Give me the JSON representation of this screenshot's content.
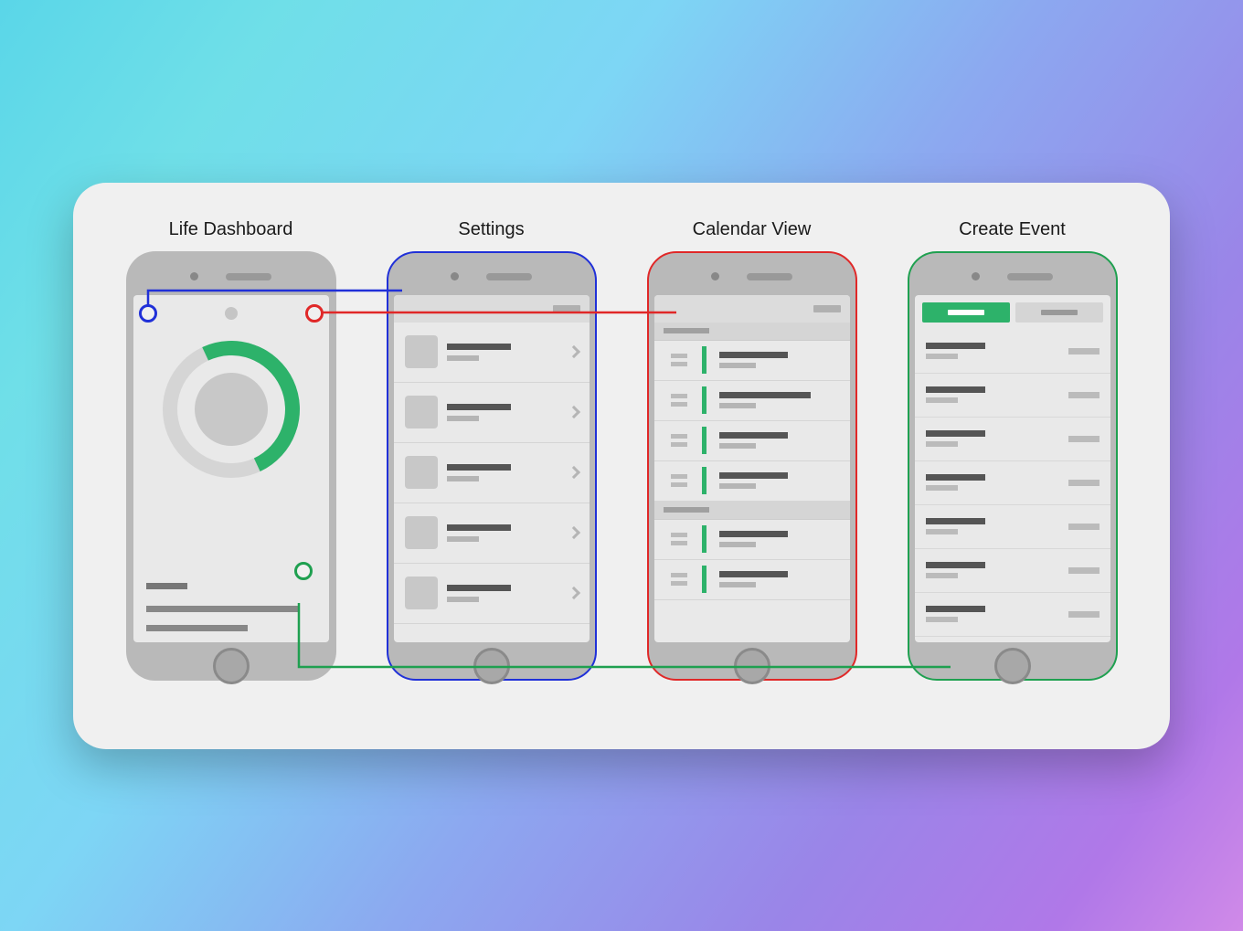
{
  "screens": [
    {
      "title": "Life Dashboard",
      "border": "none"
    },
    {
      "title": "Settings",
      "border": "blue"
    },
    {
      "title": "Calendar View",
      "border": "red"
    },
    {
      "title": "Create Event",
      "border": "green"
    }
  ],
  "colors": {
    "accent_green": "#2db26a",
    "link_blue": "#2030d8",
    "link_red": "#e02828",
    "link_green": "#1fa050",
    "frame_grey": "#b9b9b9"
  },
  "settings_items": 5,
  "calendar_sections": 2,
  "calendar_rows_per_section": [
    4,
    2
  ],
  "create_event_tabs": 2,
  "create_event_rows": 7
}
